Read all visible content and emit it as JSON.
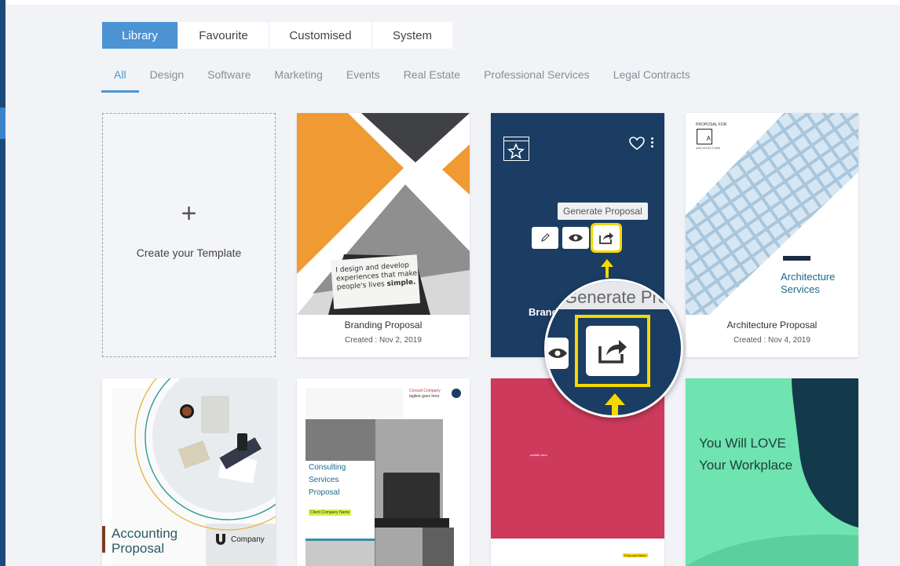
{
  "filter_tabs": [
    {
      "label": "Library",
      "active": true
    },
    {
      "label": "Favourite",
      "active": false
    },
    {
      "label": "Customised",
      "active": false
    },
    {
      "label": "System",
      "active": false
    }
  ],
  "category_tabs": [
    {
      "label": "All",
      "active": true
    },
    {
      "label": "Design",
      "active": false
    },
    {
      "label": "Software",
      "active": false
    },
    {
      "label": "Marketing",
      "active": false
    },
    {
      "label": "Events",
      "active": false
    },
    {
      "label": "Real Estate",
      "active": false
    },
    {
      "label": "Professional Services",
      "active": false
    },
    {
      "label": "Legal Contracts",
      "active": false
    }
  ],
  "create_card": {
    "plus": "+",
    "label": "Create your Template"
  },
  "templates": [
    {
      "title": "Branding Proposal",
      "date": "Created : Nov 2, 2019",
      "thumb_text": {
        "line1": "I design and develop",
        "line2": "experiences that make",
        "line3_a": "people's lives ",
        "line3_b": "simple."
      }
    },
    {
      "title": "Brand",
      "hover": true,
      "tooltip": "Generate Proposal",
      "actions": [
        "pencil-icon",
        "eye-icon",
        "share-icon"
      ]
    },
    {
      "title": "Architecture Proposal",
      "date": "Created : Nov 4, 2019",
      "thumb_text": {
        "proposal_for": "PROPOSAL FOR",
        "logo_letter": "A",
        "logo_sub": "ARCHITECTURE",
        "heading_1": "Architecture",
        "heading_2": "Services"
      }
    },
    {
      "thumb_text": {
        "heading_1": "Accounting",
        "heading_2": "Proposal",
        "company": "Company"
      }
    },
    {
      "thumb_text": {
        "brand": "Consult Company",
        "tagline": "tagline goes here",
        "heading_1": "Consulting",
        "heading_2": "Services",
        "heading_3": "Proposal",
        "client": "Client Company Name"
      }
    },
    {
      "thumb_text": {
        "small_1": "subtitle here",
        "small_2": "Proposal Name"
      }
    },
    {
      "thumb_text": {
        "heading_1": "You Will LOVE",
        "heading_2": "Your Workplace"
      }
    }
  ],
  "magnifier": {
    "tooltip_fragment": "Generate Prop"
  },
  "colors": {
    "accent": "#4b93d3",
    "navy": "#1b3d63",
    "highlight": "#f5d800",
    "orange": "#ef9a33",
    "crimson": "#cd3a5c",
    "mint": "#6fe3b0",
    "dark_teal": "#123a4a"
  }
}
